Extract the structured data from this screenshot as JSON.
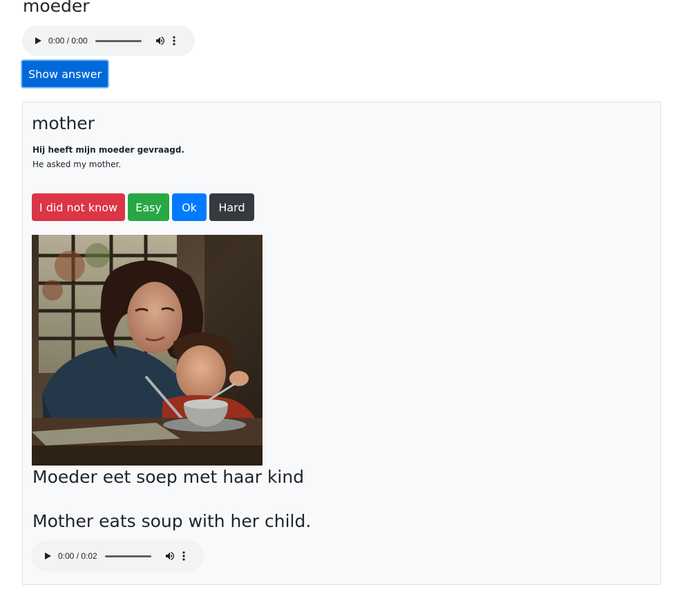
{
  "word": "moeder",
  "audio_word": {
    "time": "0:00 / 0:00"
  },
  "show_answer_label": "Show answer",
  "answer": {
    "translation": "mother",
    "example_nl": "Hij heeft mijn moeder gevraagd.",
    "example_en": "He asked my mother.",
    "buttons": {
      "did_not_know": "I did not know",
      "easy": "Easy",
      "ok": "Ok",
      "hard": "Hard"
    },
    "caption_nl": "Moeder eet soep met haar kind",
    "caption_en": "Mother eats soup with her child.",
    "audio_caption": {
      "time": "0:00 / 0:02"
    }
  },
  "colors": {
    "danger": "#dc3545",
    "success": "#28a745",
    "primary": "#007bff",
    "dark": "#343a40",
    "show_answer": "#0069d9"
  }
}
